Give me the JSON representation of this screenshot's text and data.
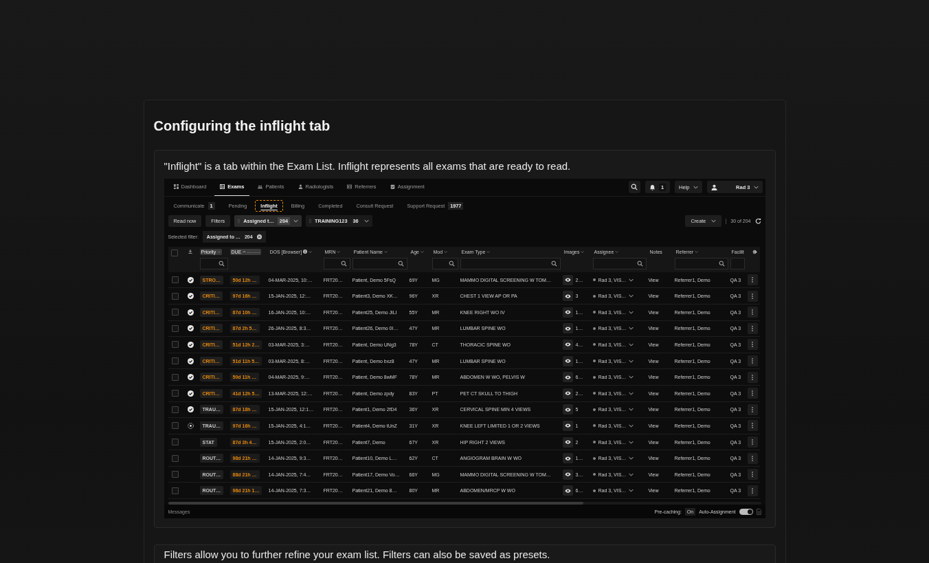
{
  "section": {
    "title": "Configuring the inflight tab",
    "intro": "\"Inflight\" is a tab within the Exam List. Inflight represents all exams that are ready to read."
  },
  "app": {
    "nav": [
      {
        "label": "Dashboard",
        "selected": false
      },
      {
        "label": "Exams",
        "selected": true
      },
      {
        "label": "Patients",
        "selected": false
      },
      {
        "label": "Radiologists",
        "selected": false
      },
      {
        "label": "Referrers",
        "selected": false
      },
      {
        "label": "Assignment",
        "selected": false
      }
    ],
    "notifications": "1",
    "help": "Help",
    "user": "Rad 3",
    "subtabs": [
      {
        "label": "Communicate",
        "count": "1",
        "selected": false,
        "highlighted": false
      },
      {
        "label": "Pending",
        "selected": false,
        "highlighted": false
      },
      {
        "label": "Inflight",
        "selected": true,
        "highlighted": true
      },
      {
        "label": "Billing",
        "selected": false,
        "highlighted": false
      },
      {
        "label": "Completed",
        "selected": false,
        "highlighted": false
      },
      {
        "label": "Consult Request",
        "selected": false,
        "highlighted": false
      },
      {
        "label": "Support Request",
        "count": "1977",
        "selected": false,
        "highlighted": false
      }
    ],
    "toolbar": {
      "read_now": "Read now",
      "filters": "Filters",
      "presets": [
        {
          "label": "Assigned t…",
          "count": "204",
          "selected": true
        },
        {
          "label": "TRAINING123",
          "count": "36",
          "selected": false
        }
      ],
      "create": "Create",
      "range": "30 of 204"
    },
    "selected_filter": {
      "label": "Selected filter:",
      "chip": "Assigned to …",
      "count": "204"
    },
    "select_all": {
      "checked": false
    },
    "columns": [
      {
        "label": "Priority",
        "pill": true,
        "sort_menu": true,
        "sorted_asc": false,
        "filter": true,
        "info": false
      },
      {
        "label": "DUE",
        "pill": true,
        "sort_menu": false,
        "sorted_asc": true,
        "filter": false,
        "info": false
      },
      {
        "label": "DOS [Browser]",
        "pill": false,
        "sort_menu": true,
        "sorted_asc": false,
        "filter": false,
        "info": true
      },
      {
        "label": "MRN",
        "pill": false,
        "sort_menu": true,
        "sorted_asc": false,
        "filter": true,
        "info": false
      },
      {
        "label": "Patient Name",
        "pill": false,
        "sort_menu": true,
        "sorted_asc": false,
        "filter": true,
        "info": false
      },
      {
        "label": "Age",
        "pill": false,
        "sort_menu": true,
        "sorted_asc": false,
        "filter": false,
        "info": false
      },
      {
        "label": "Mod",
        "pill": false,
        "sort_menu": true,
        "sorted_asc": false,
        "filter": true,
        "info": false
      },
      {
        "label": "Exam Type",
        "pill": false,
        "sort_menu": true,
        "sorted_asc": false,
        "filter": true,
        "info": false
      },
      {
        "label": "Images",
        "pill": false,
        "sort_menu": true,
        "sorted_asc": false,
        "filter": false,
        "info": false
      },
      {
        "label": "Assignee",
        "pill": false,
        "sort_menu": true,
        "sorted_asc": false,
        "filter": true,
        "info": false
      },
      {
        "label": "Notes",
        "pill": false,
        "sort_menu": false,
        "sorted_asc": false,
        "filter": false,
        "info": false
      },
      {
        "label": "Referrer",
        "pill": false,
        "sort_menu": true,
        "sorted_asc": false,
        "filter": true,
        "info": false
      },
      {
        "label": "Facilit",
        "pill": false,
        "sort_menu": false,
        "sorted_asc": false,
        "filter": true,
        "info": false
      }
    ],
    "rows": [
      {
        "checked": false,
        "kind": "done",
        "priority": "STRO…",
        "color": "#e8890c",
        "due": "50d 12h …",
        "dos": "04-MAR-2025, 10:…",
        "mrn": "FRT20…",
        "patient": "Patient, Demo 5FsQ",
        "age": "69Y",
        "mod": "MG",
        "exam": "MAMMO DIGITAL SCREENING W TOM…",
        "images": "2…",
        "assignee": "Rad 3, VIS…",
        "notes": "View",
        "referrer": "Referrer1, Demo",
        "facility": "QA 3"
      },
      {
        "checked": false,
        "kind": "done",
        "priority": "CRITI…",
        "color": "#e8890c",
        "due": "97d 16h …",
        "dos": "15-JAN-2025, 12:…",
        "mrn": "FRT20…",
        "patient": "Patient3, Demo XK…",
        "age": "96Y",
        "mod": "XR",
        "exam": "CHEST 1 VIEW AP OR PA",
        "images": "3",
        "assignee": "Rad 3, VIS…",
        "notes": "View",
        "referrer": "Referrer1, Demo",
        "facility": "QA 3"
      },
      {
        "checked": false,
        "kind": "done",
        "priority": "CRITI…",
        "color": "#e8890c",
        "due": "87d 10h …",
        "dos": "16-JAN-2025, 10:…",
        "mrn": "FRT20…",
        "patient": "Patient25, Demo JiLI",
        "age": "55Y",
        "mod": "MR",
        "exam": "KNEE RIGHT WO IV",
        "images": "1…",
        "assignee": "Rad 3, VIS…",
        "notes": "View",
        "referrer": "Referrer1, Demo",
        "facility": "QA 3"
      },
      {
        "checked": false,
        "kind": "done",
        "priority": "CRITI…",
        "color": "#e8890c",
        "due": "87d 2h 5…",
        "dos": "26-JAN-2025, 8:3…",
        "mrn": "FRT20…",
        "patient": "Patient26, Demo 0I…",
        "age": "47Y",
        "mod": "MR",
        "exam": "LUMBAR SPINE WO",
        "images": "1…",
        "assignee": "Rad 3, VIS…",
        "notes": "View",
        "referrer": "Referrer1, Demo",
        "facility": "QA 3"
      },
      {
        "checked": false,
        "kind": "done",
        "priority": "CRITI…",
        "color": "#e8890c",
        "due": "51d 12h 2…",
        "dos": "03-MAR-2025, 3:…",
        "mrn": "FRT20…",
        "patient": "Patient, Demo UNg3",
        "age": "78Y",
        "mod": "CT",
        "exam": "THORACIC SPINE WO",
        "images": "4…",
        "assignee": "Rad 3, VIS…",
        "notes": "View",
        "referrer": "Referrer1, Demo",
        "facility": "QA 3"
      },
      {
        "checked": false,
        "kind": "done",
        "priority": "CRITI…",
        "color": "#e8890c",
        "due": "51d 11h 5…",
        "dos": "03-MAR-2025, 8:…",
        "mrn": "FRT20…",
        "patient": "Patient, Demo bxz8",
        "age": "47Y",
        "mod": "MR",
        "exam": "LUMBAR SPINE WO",
        "images": "1…",
        "assignee": "Rad 3, VIS…",
        "notes": "View",
        "referrer": "Referrer1, Demo",
        "facility": "QA 3"
      },
      {
        "checked": false,
        "kind": "done",
        "priority": "CRITI…",
        "color": "#e8890c",
        "due": "50d 11h …",
        "dos": "04-MAR-2025, 9:…",
        "mrn": "FRT20…",
        "patient": "Patient, Demo 8wMF",
        "age": "78Y",
        "mod": "MR",
        "exam": "ABDOMEN W WO, PELVIS W",
        "images": "6…",
        "assignee": "Rad 3, VIS…",
        "notes": "View",
        "referrer": "Referrer1, Demo",
        "facility": "QA 3"
      },
      {
        "checked": false,
        "kind": "done",
        "priority": "CRITI…",
        "color": "#e8890c",
        "due": "41d 12h 5…",
        "dos": "13-MAR-2025, 12:…",
        "mrn": "FRT20…",
        "patient": "Patient, Demo zpdy",
        "age": "83Y",
        "mod": "PT",
        "exam": "PET CT SKULL TO THIGH",
        "images": "2…",
        "assignee": "Rad 3, VIS…",
        "notes": "View",
        "referrer": "Referrer1, Demo",
        "facility": "QA 3"
      },
      {
        "checked": false,
        "kind": "done",
        "priority": "TRAU…",
        "color": "#c8c8c8",
        "due": "87d 18h …",
        "dos": "15-JAN-2025, 12:1…",
        "mrn": "FRT20…",
        "patient": "Patient1, Demo 2fD4",
        "age": "36Y",
        "mod": "XR",
        "exam": "CERVICAL SPINE MIN 4 VIEWS",
        "images": "5",
        "assignee": "Rad 3, VIS…",
        "notes": "View",
        "referrer": "Referrer1, Demo",
        "facility": "QA 3"
      },
      {
        "checked": false,
        "kind": "pending",
        "priority": "TRAU…",
        "color": "#c8c8c8",
        "due": "97d 16h …",
        "dos": "15-JAN-2025, 4:1…",
        "mrn": "FRT20…",
        "patient": "Patient4, Demo tUnZ",
        "age": "31Y",
        "mod": "XR",
        "exam": "KNEE LEFT LIMITED 1 OR 2 VIEWS",
        "images": "1",
        "assignee": "Rad 3, VIS…",
        "notes": "View",
        "referrer": "Referrer1, Demo",
        "facility": "QA 3"
      },
      {
        "checked": false,
        "kind": "plain",
        "priority": "STAT",
        "color": "#c8c8c8",
        "due": "87d 3h 4…",
        "dos": "15-JAN-2025, 2:0…",
        "mrn": "FRT20…",
        "patient": "Patient7, Demo",
        "age": "67Y",
        "mod": "XR",
        "exam": "HIP RIGHT 2 VIEWS",
        "images": "2",
        "assignee": "Rad 3, VIS…",
        "notes": "View",
        "referrer": "Referrer1, Demo",
        "facility": "QA 3"
      },
      {
        "checked": false,
        "kind": "plain",
        "priority": "ROUT…",
        "color": "#c8c8c8",
        "due": "98d 21h …",
        "dos": "14-JAN-2025, 9:3…",
        "mrn": "FRT20…",
        "patient": "Patient10, Demo L…",
        "age": "62Y",
        "mod": "CT",
        "exam": "ANGIOGRAM BRAIN W WO",
        "images": "1…",
        "assignee": "Rad 3, VIS…",
        "notes": "View",
        "referrer": "Referrer1, Demo",
        "facility": "QA 3"
      },
      {
        "checked": false,
        "kind": "plain",
        "priority": "ROUT…",
        "color": "#c8c8c8",
        "due": "88d 21h …",
        "dos": "14-JAN-2025, 7:4…",
        "mrn": "FRT20…",
        "patient": "Patient17, Demo Vo…",
        "age": "66Y",
        "mod": "MG",
        "exam": "MAMMO DIGITAL SCREENING W TOM…",
        "images": "3…",
        "assignee": "Rad 3, VIS…",
        "notes": "View",
        "referrer": "Referrer1, Demo",
        "facility": "QA 3"
      },
      {
        "checked": false,
        "kind": "plain",
        "priority": "ROUT…",
        "color": "#c8c8c8",
        "due": "98d 21h 1…",
        "dos": "14-JAN-2025, 7:3…",
        "mrn": "FRT20…",
        "patient": "Patient21, Demo 8…",
        "age": "80Y",
        "mod": "MR",
        "exam": "ABDOMEN/MRCP W WO",
        "images": "6…",
        "assignee": "Rad 3, VIS…",
        "notes": "View",
        "referrer": "Referrer1, Demo",
        "facility": "QA 3"
      }
    ],
    "footer": {
      "messages": "Messages",
      "precaching_label": "Pre-caching:",
      "precaching": "On",
      "auto_assignment": "Auto-Assignment",
      "auto_on": true
    }
  },
  "next_section": {
    "intro": "Filters allow you to further refine your exam list. Filters can also be saved as presets."
  }
}
